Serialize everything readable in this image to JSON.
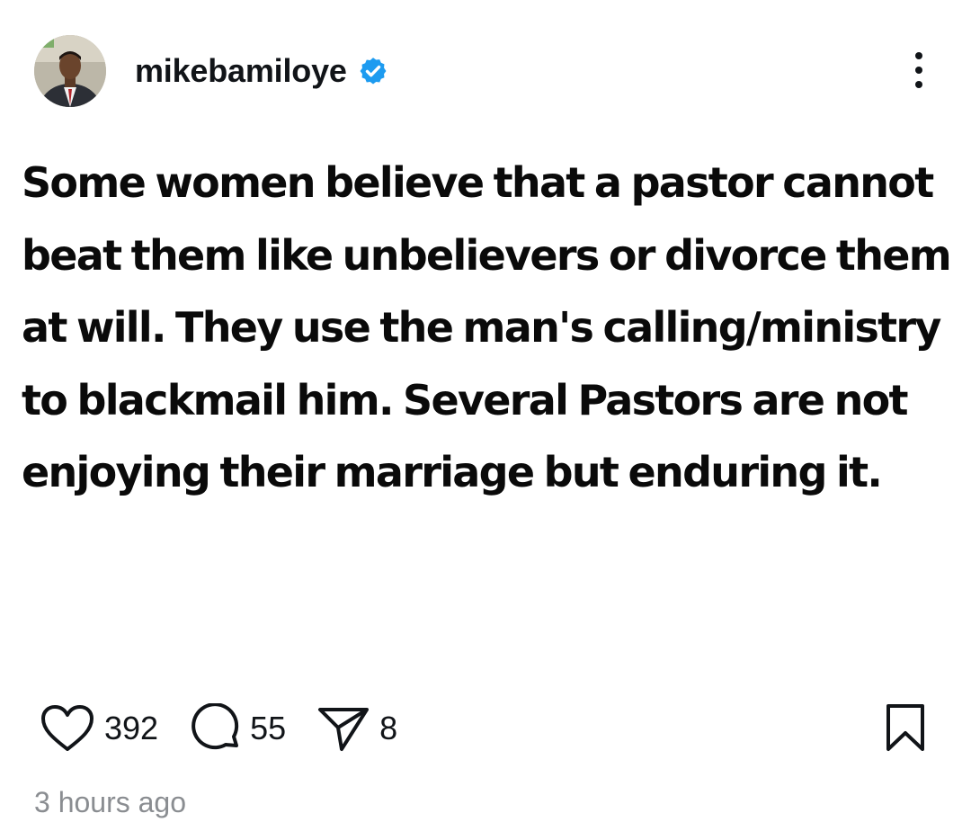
{
  "post": {
    "author": {
      "username": "mikebamiloye",
      "verified": true,
      "avatar": "profile-photo"
    },
    "text": "Some women believe that a pastor cannot beat them like unbelievers or divorce them at will. They use the man's calling/ministry to blackmail him. Several Pastors are not enjoying their marriage but enduring it.",
    "actions": {
      "likes": "392",
      "comments": "55",
      "shares": "8"
    },
    "timestamp": "3 hours ago"
  },
  "icons": {
    "more": "more-vertical-icon",
    "like": "heart-icon",
    "comment": "comment-bubble-icon",
    "share": "send-icon",
    "bookmark": "bookmark-icon",
    "verified": "verified-badge-icon"
  },
  "colors": {
    "text": "#0f1419",
    "verified_blue": "#1d9bf0",
    "timestamp_gray": "#8a8d91",
    "background": "#ffffff"
  }
}
